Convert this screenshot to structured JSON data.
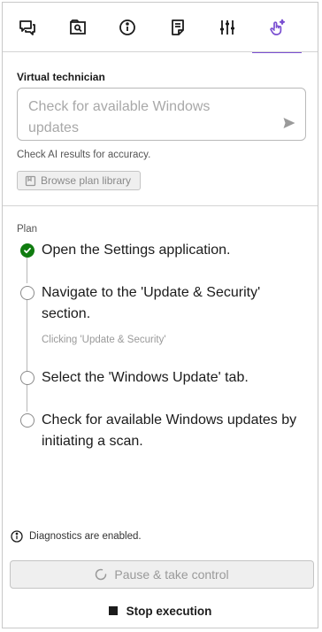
{
  "tabs": [
    {
      "icon": "chat-icon"
    },
    {
      "icon": "search-window-icon"
    },
    {
      "icon": "info-icon"
    },
    {
      "icon": "notes-icon"
    },
    {
      "icon": "sliders-icon"
    },
    {
      "icon": "sparkle-touch-icon",
      "active": true
    }
  ],
  "technician": {
    "label": "Virtual technician",
    "placeholder": "Check for available Windows updates",
    "disclaimer": "Check AI results for accuracy.",
    "browse_label": "Browse plan library"
  },
  "plan": {
    "header": "Plan",
    "steps": [
      {
        "text": "Open the Settings application.",
        "status": "done"
      },
      {
        "text": "Navigate to the 'Update & Security' section.",
        "status": "in-progress",
        "substatus": "Clicking 'Update & Security'"
      },
      {
        "text": "Select the 'Windows Update' tab.",
        "status": "pending"
      },
      {
        "text": "Check for available Windows updates by initiating a scan.",
        "status": "pending"
      }
    ]
  },
  "footer": {
    "diagnostics": "Diagnostics are enabled.",
    "pause_label": "Pause & take control",
    "stop_label": "Stop execution"
  },
  "colors": {
    "accent": "#7a4fd1",
    "success": "#107c10"
  }
}
